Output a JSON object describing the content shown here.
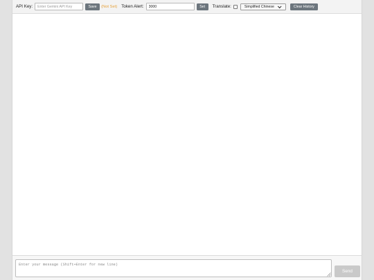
{
  "toolbar": {
    "api_key_label": "API Key:",
    "api_key_placeholder": "Enter Gemini API Key",
    "api_key_value": "",
    "save_label": "Save",
    "status_text": "(Not Set)",
    "status_color": "#e6a23c",
    "token_alert_label": "Token Alert:",
    "token_alert_value": "3000",
    "set_label": "Set",
    "translate_label": "Translate:",
    "translate_checked": false,
    "language_selected": "Simplified Chinese",
    "clear_history_label": "Clear History",
    "button_color": "#6c757d"
  },
  "composer": {
    "message_placeholder": "Enter your message (Shift+Enter for new line)",
    "message_value": "",
    "send_label": "Send",
    "send_color": "#c9c9c9"
  }
}
